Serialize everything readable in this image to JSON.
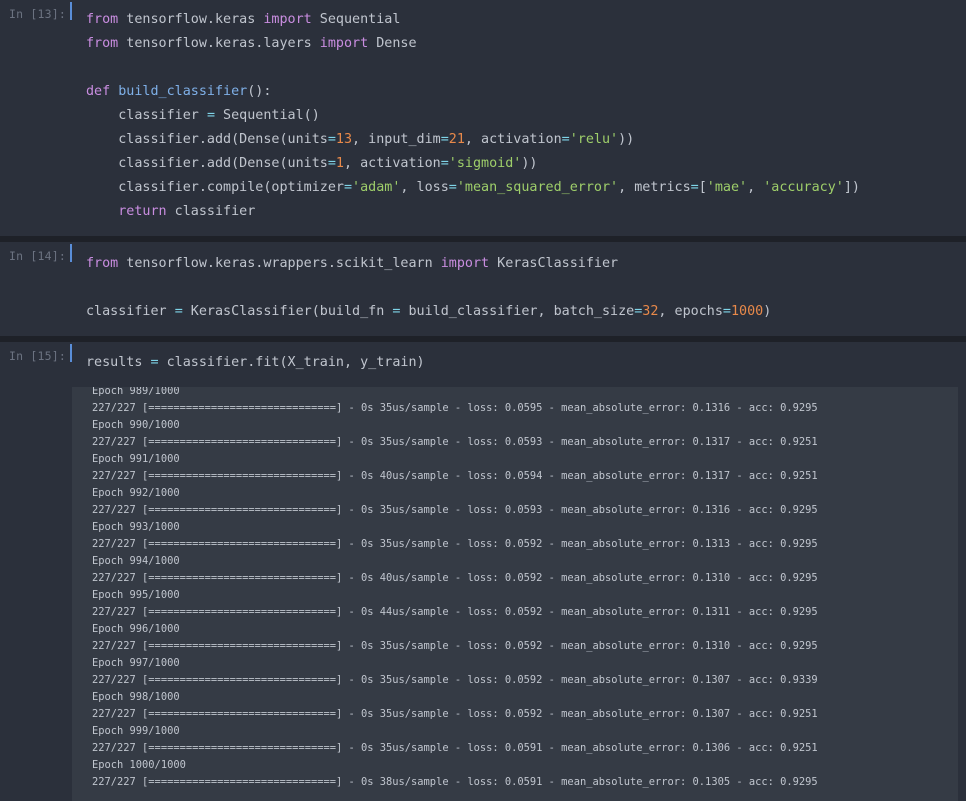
{
  "cells": [
    {
      "prompt": "In [13]:",
      "lines": [
        [
          [
            "from",
            "kw"
          ],
          [
            " tensorflow.keras ",
            ""
          ],
          [
            "import",
            "kw"
          ],
          [
            " Sequential",
            ""
          ]
        ],
        [
          [
            "from",
            "kw"
          ],
          [
            " tensorflow.keras.layers ",
            ""
          ],
          [
            "import",
            "kw"
          ],
          [
            " Dense",
            ""
          ]
        ],
        [],
        [
          [
            "def",
            "kw"
          ],
          [
            " ",
            ""
          ],
          [
            "build_classifier",
            "fn"
          ],
          [
            "():",
            ""
          ]
        ],
        [
          [
            "    classifier ",
            ""
          ],
          [
            "=",
            "op"
          ],
          [
            " Sequential()",
            ""
          ]
        ],
        [
          [
            "    classifier.add(Dense(units",
            ""
          ],
          [
            "=",
            "op"
          ],
          [
            "13",
            "num"
          ],
          [
            ", input_dim",
            ""
          ],
          [
            "=",
            "op"
          ],
          [
            "21",
            "num"
          ],
          [
            ", activation",
            ""
          ],
          [
            "=",
            "op"
          ],
          [
            "'relu'",
            "str"
          ],
          [
            "))",
            ""
          ]
        ],
        [
          [
            "    classifier.add(Dense(units",
            ""
          ],
          [
            "=",
            "op"
          ],
          [
            "1",
            "num"
          ],
          [
            ", activation",
            ""
          ],
          [
            "=",
            "op"
          ],
          [
            "'sigmoid'",
            "str"
          ],
          [
            "))",
            ""
          ]
        ],
        [
          [
            "    classifier.compile(optimizer",
            ""
          ],
          [
            "=",
            "op"
          ],
          [
            "'adam'",
            "str"
          ],
          [
            ", loss",
            ""
          ],
          [
            "=",
            "op"
          ],
          [
            "'mean_squared_error'",
            "str"
          ],
          [
            ", metrics",
            ""
          ],
          [
            "=",
            "op"
          ],
          [
            "[",
            ""
          ],
          [
            "'mae'",
            "str"
          ],
          [
            ", ",
            ""
          ],
          [
            "'accuracy'",
            "str"
          ],
          [
            "])",
            ""
          ]
        ],
        [
          [
            "    ",
            ""
          ],
          [
            "return",
            "kw"
          ],
          [
            " classifier",
            ""
          ]
        ]
      ]
    },
    {
      "prompt": "In [14]:",
      "lines": [
        [
          [
            "from",
            "kw"
          ],
          [
            " tensorflow.keras.wrappers.scikit_learn ",
            ""
          ],
          [
            "import",
            "kw"
          ],
          [
            " KerasClassifier",
            ""
          ]
        ],
        [],
        [
          [
            "classifier ",
            ""
          ],
          [
            "=",
            "op"
          ],
          [
            " KerasClassifier(build_fn ",
            ""
          ],
          [
            "=",
            "op"
          ],
          [
            " build_classifier, batch_size",
            ""
          ],
          [
            "=",
            "op"
          ],
          [
            "32",
            "num"
          ],
          [
            ", epochs",
            ""
          ],
          [
            "=",
            "op"
          ],
          [
            "1000",
            "num"
          ],
          [
            ")",
            ""
          ]
        ]
      ]
    },
    {
      "prompt": "In [15]:",
      "lines": [
        [
          [
            "results ",
            ""
          ],
          [
            "=",
            "op"
          ],
          [
            " classifier.fit(X_train, y_train)",
            ""
          ]
        ]
      ]
    }
  ],
  "output_lines": [
    "Epoch 989/1000",
    "227/227 [==============================] - 0s 35us/sample - loss: 0.0595 - mean_absolute_error: 0.1316 - acc: 0.9295",
    "Epoch 990/1000",
    "227/227 [==============================] - 0s 35us/sample - loss: 0.0593 - mean_absolute_error: 0.1317 - acc: 0.9251",
    "Epoch 991/1000",
    "227/227 [==============================] - 0s 40us/sample - loss: 0.0594 - mean_absolute_error: 0.1317 - acc: 0.9251",
    "Epoch 992/1000",
    "227/227 [==============================] - 0s 35us/sample - loss: 0.0593 - mean_absolute_error: 0.1316 - acc: 0.9295",
    "Epoch 993/1000",
    "227/227 [==============================] - 0s 35us/sample - loss: 0.0592 - mean_absolute_error: 0.1313 - acc: 0.9295",
    "Epoch 994/1000",
    "227/227 [==============================] - 0s 40us/sample - loss: 0.0592 - mean_absolute_error: 0.1310 - acc: 0.9295",
    "Epoch 995/1000",
    "227/227 [==============================] - 0s 44us/sample - loss: 0.0592 - mean_absolute_error: 0.1311 - acc: 0.9295",
    "Epoch 996/1000",
    "227/227 [==============================] - 0s 35us/sample - loss: 0.0592 - mean_absolute_error: 0.1310 - acc: 0.9295",
    "Epoch 997/1000",
    "227/227 [==============================] - 0s 35us/sample - loss: 0.0592 - mean_absolute_error: 0.1307 - acc: 0.9339",
    "Epoch 998/1000",
    "227/227 [==============================] - 0s 35us/sample - loss: 0.0592 - mean_absolute_error: 0.1307 - acc: 0.9251",
    "Epoch 999/1000",
    "227/227 [==============================] - 0s 35us/sample - loss: 0.0591 - mean_absolute_error: 0.1306 - acc: 0.9251",
    "Epoch 1000/1000",
    "227/227 [==============================] - 0s 38us/sample - loss: 0.0591 - mean_absolute_error: 0.1305 - acc: 0.9295"
  ],
  "colors": {
    "keyword": "#c98de0",
    "function": "#7fb0e8",
    "string": "#9ece6a",
    "number": "#e8894a",
    "operator": "#7fd4e8",
    "text": "#c0c5ce",
    "prompt_bar": "#5a8ed8"
  }
}
